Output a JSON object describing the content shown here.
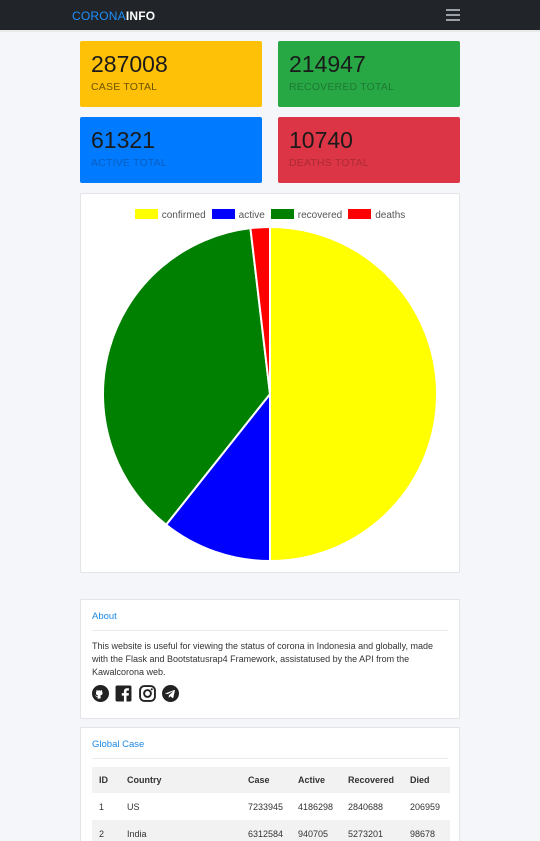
{
  "navbar": {
    "brand_part1": "CORONA",
    "brand_part2": "INFO",
    "menu_icon": "hamburger-icon"
  },
  "stats": {
    "case": {
      "value": "287008",
      "label": "CASE TOTAL",
      "color": "#ffc107"
    },
    "recovered": {
      "value": "214947",
      "label": "RECOVERED TOTAL",
      "color": "#28a745"
    },
    "active": {
      "value": "61321",
      "label": "ACTIVE TOTAL",
      "color": "#007bff"
    },
    "deaths": {
      "value": "10740",
      "label": "DEATHS TOTAL",
      "color": "#dc3545"
    }
  },
  "chart_data": {
    "type": "pie",
    "categories": [
      "confirmed",
      "active",
      "recovered",
      "deaths"
    ],
    "values": [
      287008,
      61321,
      214947,
      10740
    ],
    "colors": [
      "#ffff00",
      "#0000ff",
      "#008000",
      "#ff0000"
    ],
    "legend_position": "top"
  },
  "about": {
    "title": "About",
    "text": "This website is useful for viewing the status of corona in Indonesia and globally, made with the Flask and Bootstatusrap4 Framework, assistatused by the API from the Kawalcorona web.",
    "social_icons": [
      "github-icon",
      "facebook-icon",
      "instagram-icon",
      "telegram-icon"
    ]
  },
  "global_case": {
    "title": "Global Case",
    "columns": [
      "ID",
      "Country",
      "Case",
      "Active",
      "Recovered",
      "Died"
    ],
    "rows": [
      [
        "1",
        "US",
        "7233945",
        "4186298",
        "2840688",
        "206959"
      ],
      [
        "2",
        "India",
        "6312584",
        "940705",
        "5273201",
        "98678"
      ]
    ]
  }
}
